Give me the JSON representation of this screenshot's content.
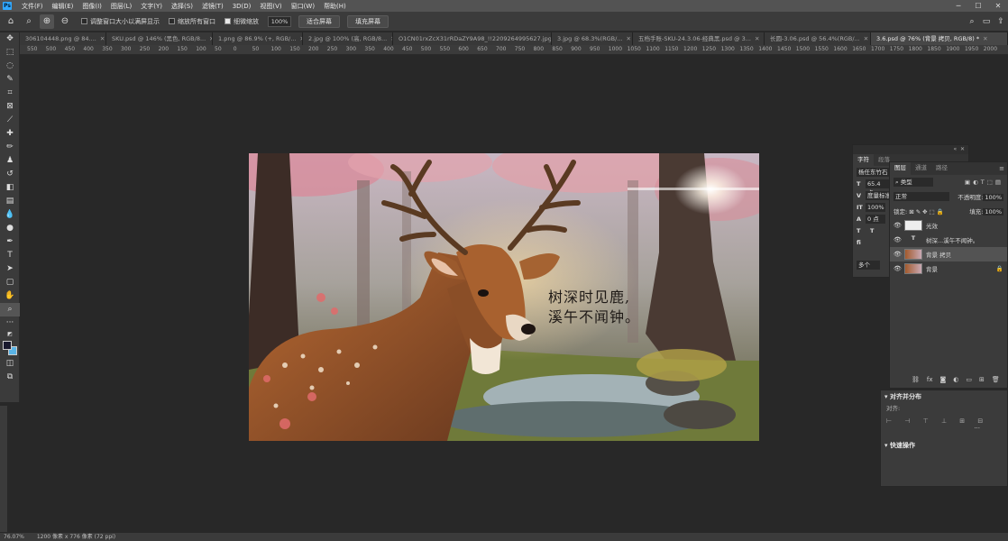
{
  "menubar": {
    "logo": "Ps",
    "items": [
      "文件(F)",
      "编辑(E)",
      "图像(I)",
      "图层(L)",
      "文字(Y)",
      "选择(S)",
      "滤镜(T)",
      "3D(D)",
      "视图(V)",
      "窗口(W)",
      "帮助(H)"
    ],
    "window_controls": [
      "─",
      "☐",
      "✕"
    ]
  },
  "options": {
    "checkbox_resize": "调整窗口大小以满屏显示",
    "checkbox_zoom_all": "缩放所有窗口",
    "checkbox_scrubby": "细微缩放",
    "zoom_value": "100%",
    "fit_screen": "适合屏幕",
    "fill_screen": "填充屏幕"
  },
  "tabs": [
    {
      "label": "306104448.png @ 84....",
      "active": false
    },
    {
      "label": "SKU.psd @ 146% (黑色, RGB/8...",
      "active": false
    },
    {
      "label": "1.png @ 86.9% (+, RGB/...",
      "active": false
    },
    {
      "label": "2.jpg @ 100% (高, RGB/8...",
      "active": false
    },
    {
      "label": "O1CN01rxZcX31rRDaZY9A98_!!2209264995627.jpg",
      "active": false
    },
    {
      "label": "3.jpg @ 68.3%(RGB/...",
      "active": false
    },
    {
      "label": "五档手账-SKU-24.3.06-经典黑.psd @ 3...",
      "active": false
    },
    {
      "label": "长圆-3.06.psd @ 56.4%(RGB/...",
      "active": false
    },
    {
      "label": "3.6.psd @ 76% (背景 拷贝, RGB/8) *",
      "active": true
    }
  ],
  "ruler_ticks": [
    "550",
    "500",
    "450",
    "400",
    "350",
    "300",
    "250",
    "200",
    "150",
    "100",
    "50",
    "0",
    "50",
    "100",
    "150",
    "200",
    "250",
    "300",
    "350",
    "400",
    "450",
    "500",
    "550",
    "600",
    "650",
    "700",
    "750",
    "800",
    "850",
    "900",
    "950",
    "1000",
    "1050",
    "1100",
    "1150",
    "1200",
    "1250",
    "1300",
    "1350",
    "1400",
    "1450",
    "1500",
    "1550",
    "1600",
    "1650",
    "1700",
    "1750",
    "1800",
    "1850",
    "1900",
    "1950",
    "2000"
  ],
  "artwork": {
    "line1": "树深时见鹿,",
    "line2": "溪午不闻钟。"
  },
  "character_panel": {
    "tab_char": "字符",
    "tab_para": "段落",
    "font": "杨任东竹石",
    "size": "65.4 点",
    "kerning": "度量标准",
    "scale": "100%",
    "baseline": "0 点",
    "multi": "多个"
  },
  "layers_panel": {
    "tab_layers": "图层",
    "tab_channels": "通道",
    "tab_paths": "路径",
    "filter": "类型",
    "blend_mode": "正常",
    "opacity_label": "不透明度:",
    "opacity": "100%",
    "lock_label": "锁定:",
    "fill_label": "填充:",
    "fill": "100%",
    "layers": [
      {
        "name": "光效",
        "kind": "image",
        "selected": false
      },
      {
        "name": "树深...溪午不闻钟。",
        "kind": "text",
        "selected": false
      },
      {
        "name": "背景 拷贝",
        "kind": "image",
        "selected": true
      },
      {
        "name": "背景",
        "kind": "image",
        "selected": false
      }
    ]
  },
  "align_panel": {
    "title": "对齐并分布",
    "align_label": "对齐:",
    "quick_actions": "快速操作"
  },
  "status": {
    "zoom": "76.07%",
    "info": "1200 像素 x 776 像素 (72 ppi)"
  },
  "colors": {
    "accent": "#31a8ff",
    "foreground": "#1a1a2e",
    "background": "#5ab4e6"
  }
}
